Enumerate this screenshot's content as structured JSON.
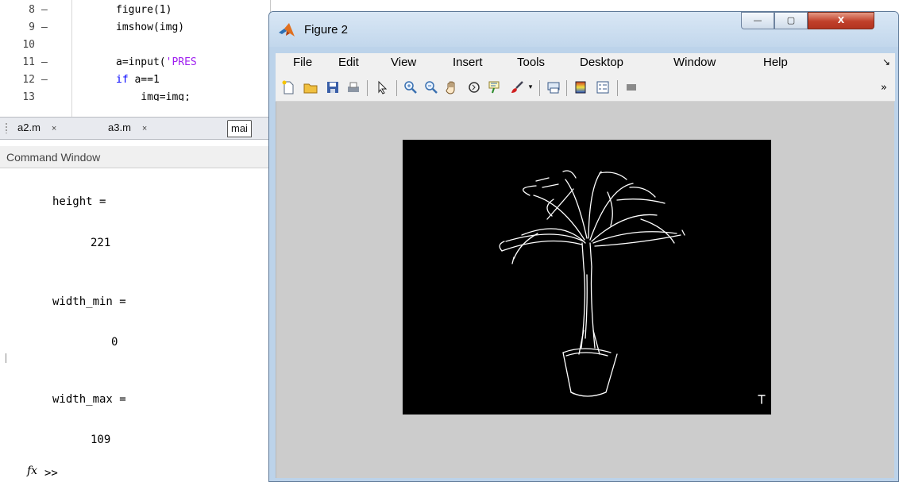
{
  "editor": {
    "lines": [
      {
        "num": "8",
        "dash": "–",
        "code": "figure(1)"
      },
      {
        "num": "9",
        "dash": "–",
        "code": "imshow(img)"
      },
      {
        "num": "10",
        "dash": "",
        "code": ""
      },
      {
        "num": "11",
        "dash": "–",
        "code_pre": "a=input(",
        "code_str": "'PRES"
      },
      {
        "num": "12",
        "dash": "–",
        "code_kw": "if",
        "code_rest": " a==1"
      },
      {
        "num": "13",
        "dash": "",
        "code": "    img=img;"
      }
    ]
  },
  "tabs": [
    {
      "label": "a2.m",
      "close": "×"
    },
    {
      "label": "a3.m",
      "close": "×"
    },
    {
      "label": "mai",
      "close": ""
    }
  ],
  "command_window": {
    "title": "Command Window",
    "lines": [
      {
        "text": "height ="
      },
      {
        "text": "221"
      },
      {
        "text": "width_min ="
      },
      {
        "text": "0"
      },
      {
        "text": "width_max ="
      },
      {
        "text": "109"
      }
    ],
    "fx_label": "fx",
    "prompt": ">>"
  },
  "figure": {
    "title": "Figure 2",
    "window_buttons": {
      "minimize": "—",
      "maximize": "▢",
      "close": "X"
    },
    "menu": [
      "File",
      "Edit",
      "View",
      "Insert",
      "Tools",
      "Desktop",
      "Window",
      "Help"
    ],
    "menu_overflow": "↘",
    "toolbar_overflow": "»",
    "toolbar_icons": [
      "new-figure-icon",
      "open-file-icon",
      "save-icon",
      "print-icon",
      "pointer-icon",
      "zoom-in-icon",
      "zoom-out-icon",
      "pan-hand-icon",
      "rotate-3d-icon",
      "data-cursor-icon",
      "brush-icon",
      "dropdown-icon",
      "link-plot-icon",
      "colorbar-icon",
      "legend-icon",
      "hide-plot-tools-icon"
    ],
    "colors": {
      "titlebar": "#c2d7ec",
      "canvas": "#cccccc",
      "axes": "#000000",
      "close": "#c0402a"
    }
  }
}
